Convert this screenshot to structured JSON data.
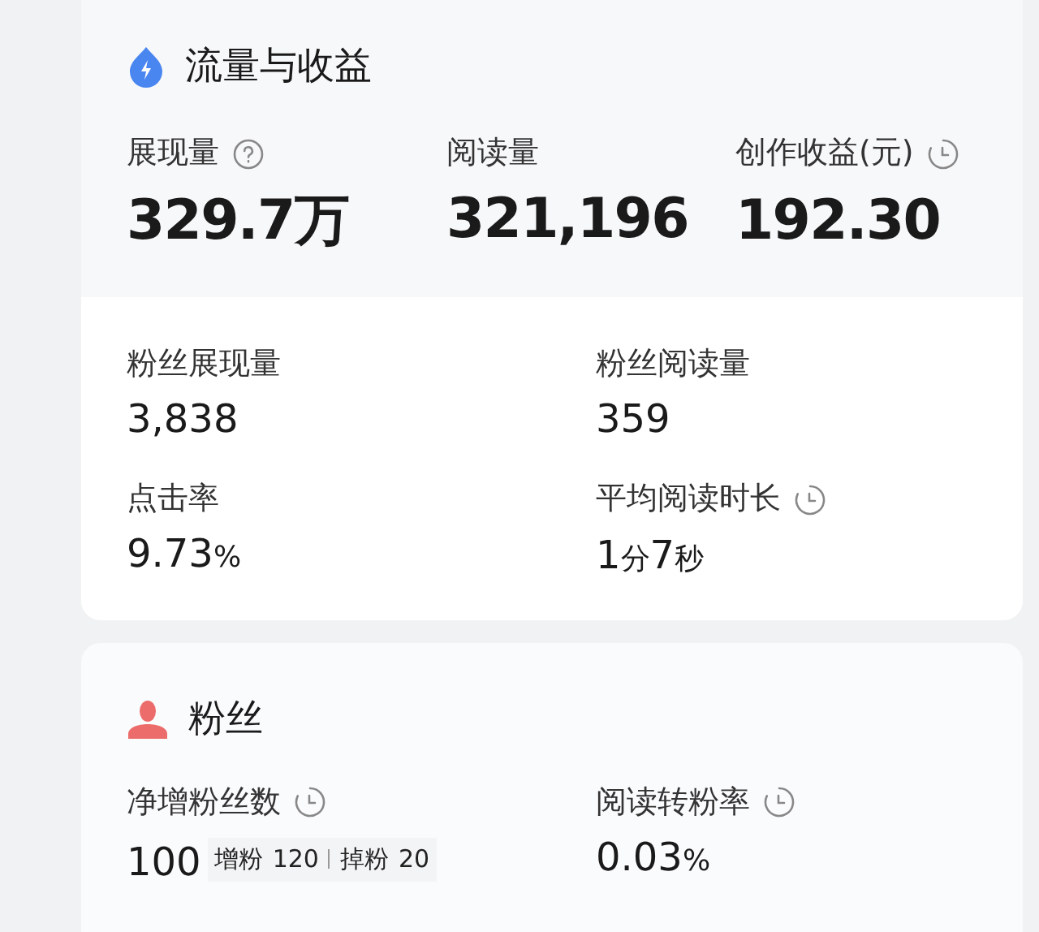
{
  "traffic_section": {
    "title": "流量与收益",
    "main_metrics": [
      {
        "label": "展现量",
        "hint": {
          "kind": "help"
        },
        "value": "329.7万"
      },
      {
        "label": "阅读量",
        "value": "321,196"
      },
      {
        "label": "创作收益(元)",
        "hint": {
          "kind": "clock"
        },
        "value": "192.30"
      }
    ],
    "sub_metrics": [
      {
        "label": "粉丝展现量",
        "value": "3,838"
      },
      {
        "label": "粉丝阅读量",
        "value": "359"
      },
      {
        "label": "点击率",
        "value": [
          {
            "text": "9.73",
            "kind": "number"
          },
          {
            "text": "%",
            "kind": "unit"
          }
        ]
      },
      {
        "label": "平均阅读时长",
        "hint": {
          "kind": "clock"
        },
        "value": [
          {
            "text": "1",
            "kind": "number"
          },
          {
            "text": "分",
            "kind": "unit"
          },
          {
            "text": "7",
            "kind": "number"
          },
          {
            "text": "秒",
            "kind": "unit"
          }
        ]
      }
    ]
  },
  "fans_section": {
    "title": "粉丝",
    "metrics": [
      {
        "label": "净增粉丝数",
        "hint": {
          "kind": "clock"
        },
        "value": "100",
        "breakdown": [
          {
            "label": "增粉",
            "value": "120"
          },
          {
            "label": "掉粉",
            "value": "20"
          }
        ]
      },
      {
        "label": "阅读转粉率",
        "hint": {
          "kind": "clock"
        },
        "value": [
          {
            "text": "0.03",
            "kind": "number"
          },
          {
            "text": "%",
            "kind": "unit"
          }
        ]
      }
    ]
  }
}
